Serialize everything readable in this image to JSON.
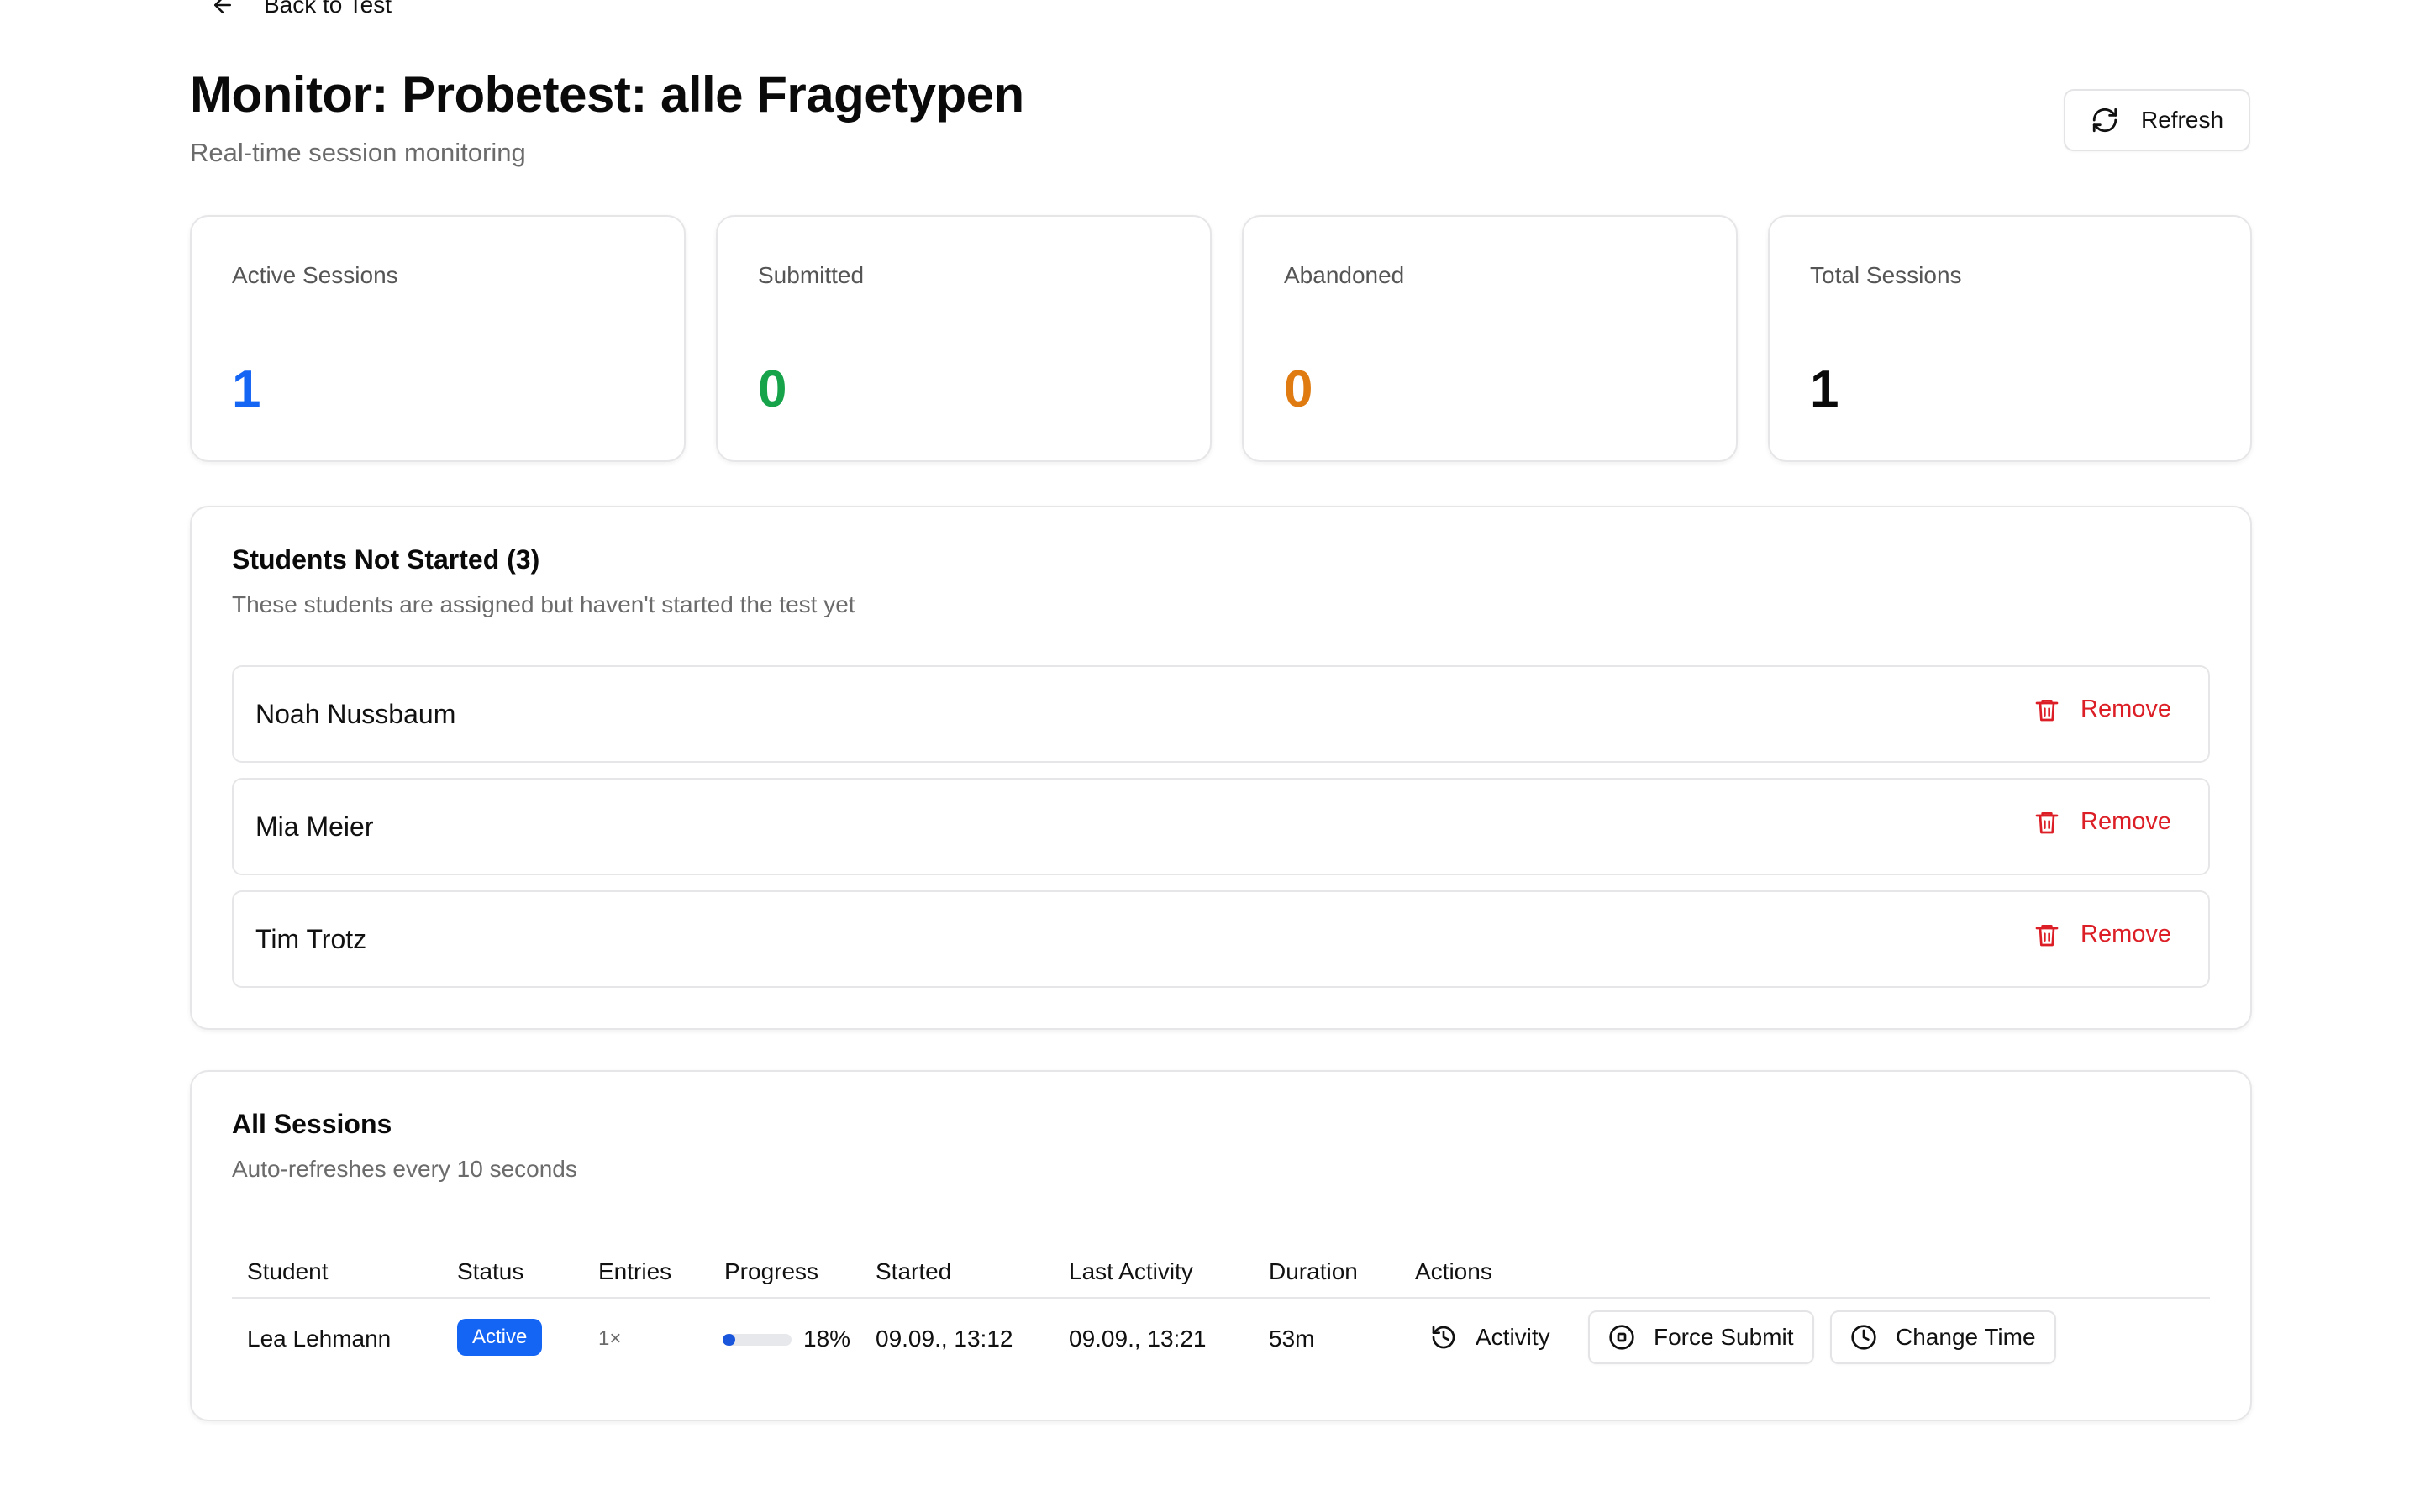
{
  "header": {
    "back_label": "Back to Test",
    "title": "Monitor: Probetest: alle Fragetypen",
    "subtitle": "Real-time session monitoring",
    "refresh_label": "Refresh"
  },
  "stats": [
    {
      "label": "Active Sessions",
      "value": "1",
      "color": "#1565f5"
    },
    {
      "label": "Submitted",
      "value": "0",
      "color": "#16a34a"
    },
    {
      "label": "Abandoned",
      "value": "0",
      "color": "#e07b12"
    },
    {
      "label": "Total Sessions",
      "value": "1",
      "color": "#0a0a0a"
    }
  ],
  "not_started": {
    "title": "Students Not Started (3)",
    "description": "These students are assigned but haven't started the test yet",
    "remove_label": "Remove",
    "students": [
      "Noah Nussbaum",
      "Mia Meier",
      "Tim Trotz"
    ]
  },
  "sessions": {
    "title": "All Sessions",
    "description": "Auto-refreshes every 10 seconds",
    "columns": [
      "Student",
      "Status",
      "Entries",
      "Progress",
      "Started",
      "Last Activity",
      "Duration",
      "Actions"
    ],
    "rows": [
      {
        "student": "Lea Lehmann",
        "status": "Active",
        "entries": "1×",
        "progress": 18,
        "progress_label": "18%",
        "started": "09.09., 13:12",
        "last_activity": "09.09., 13:21",
        "duration": "53m",
        "actions": [
          "Activity",
          "Force Submit",
          "Change Time"
        ]
      }
    ]
  },
  "colors": {
    "accent": "#1565f5",
    "danger": "#dc1f26",
    "border": "#e6e6e8"
  }
}
